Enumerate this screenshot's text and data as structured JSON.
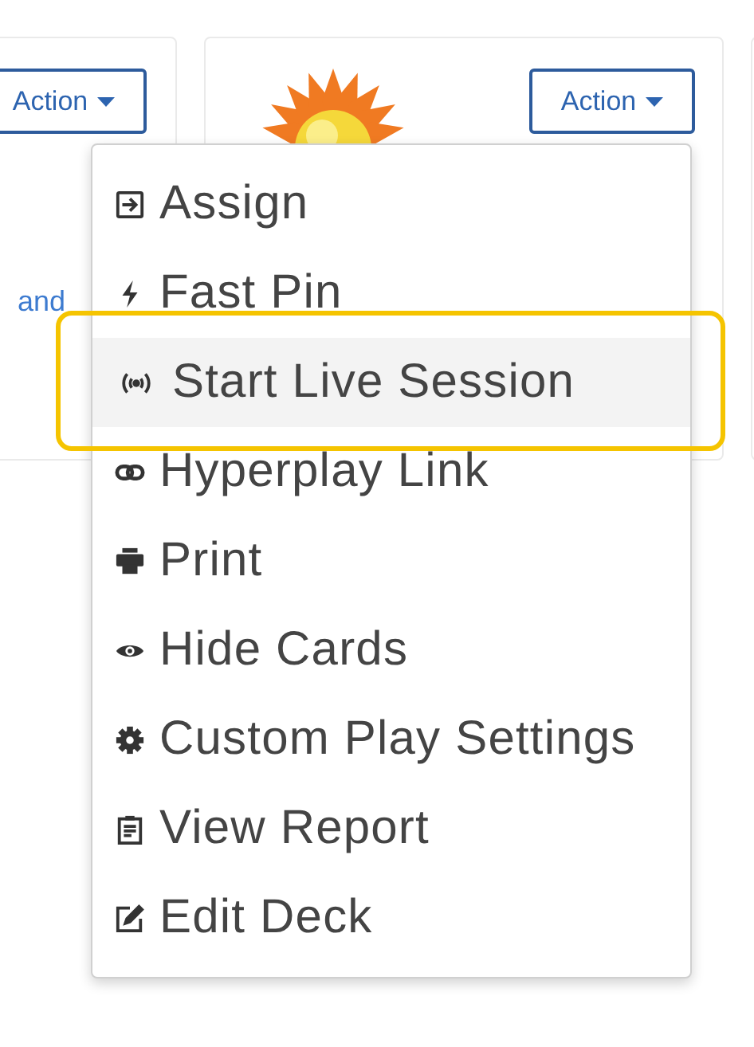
{
  "cards": [
    {
      "action_button": {
        "label": "Action"
      },
      "link": "and"
    },
    {
      "action_button": {
        "label": "Action"
      }
    }
  ],
  "menu": {
    "items": [
      {
        "kind": "assign",
        "label": "Assign",
        "selected": false
      },
      {
        "kind": "bolt",
        "label": "Fast Pin",
        "selected": false
      },
      {
        "kind": "broadcast",
        "label": "Start Live Session",
        "selected": true
      },
      {
        "kind": "link",
        "label": "Hyperplay Link",
        "selected": false
      },
      {
        "kind": "print",
        "label": "Print",
        "selected": false
      },
      {
        "kind": "eye",
        "label": "Hide Cards",
        "selected": false
      },
      {
        "kind": "gear",
        "label": "Custom Play Settings",
        "selected": false
      },
      {
        "kind": "report",
        "label": "View Report",
        "selected": false
      },
      {
        "kind": "edit",
        "label": "Edit Deck",
        "selected": false
      }
    ]
  }
}
